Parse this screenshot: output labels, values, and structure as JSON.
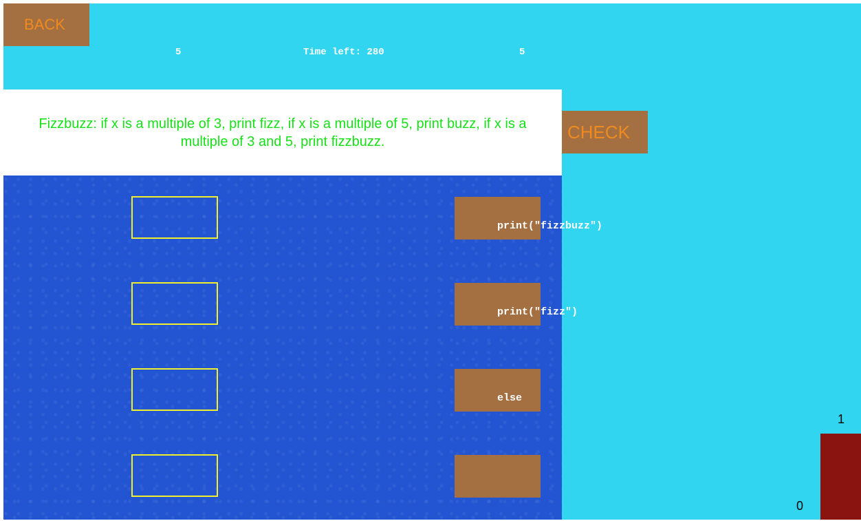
{
  "header": {
    "back_label": "BACK",
    "left_value": "5",
    "timer_label": "Time left: 280",
    "right_value": "5"
  },
  "prompt": {
    "text": "Fizzbuzz: if x is a multiple of 3, print fizz, if x is a multiple of 5, print buzz, if x is a multiple of 3 and 5, print fizzbuzz."
  },
  "check_label": "CHECK",
  "slots": [
    {
      "value": ""
    },
    {
      "value": ""
    },
    {
      "value": ""
    },
    {
      "value": ""
    }
  ],
  "tiles": [
    {
      "label": "print(\"fizzbuzz\")"
    },
    {
      "label": "print(\"fizz\")"
    },
    {
      "label": "else"
    },
    {
      "label": ""
    }
  ],
  "score": {
    "top": "1",
    "bottom": "0"
  },
  "colors": {
    "background": "#31d5f0",
    "board": "#2355d2",
    "button": "#a47041",
    "button_text": "#f08a1f",
    "prompt_text": "#18e018",
    "slot_border": "#f1f02a",
    "bar": "#8a1410"
  }
}
